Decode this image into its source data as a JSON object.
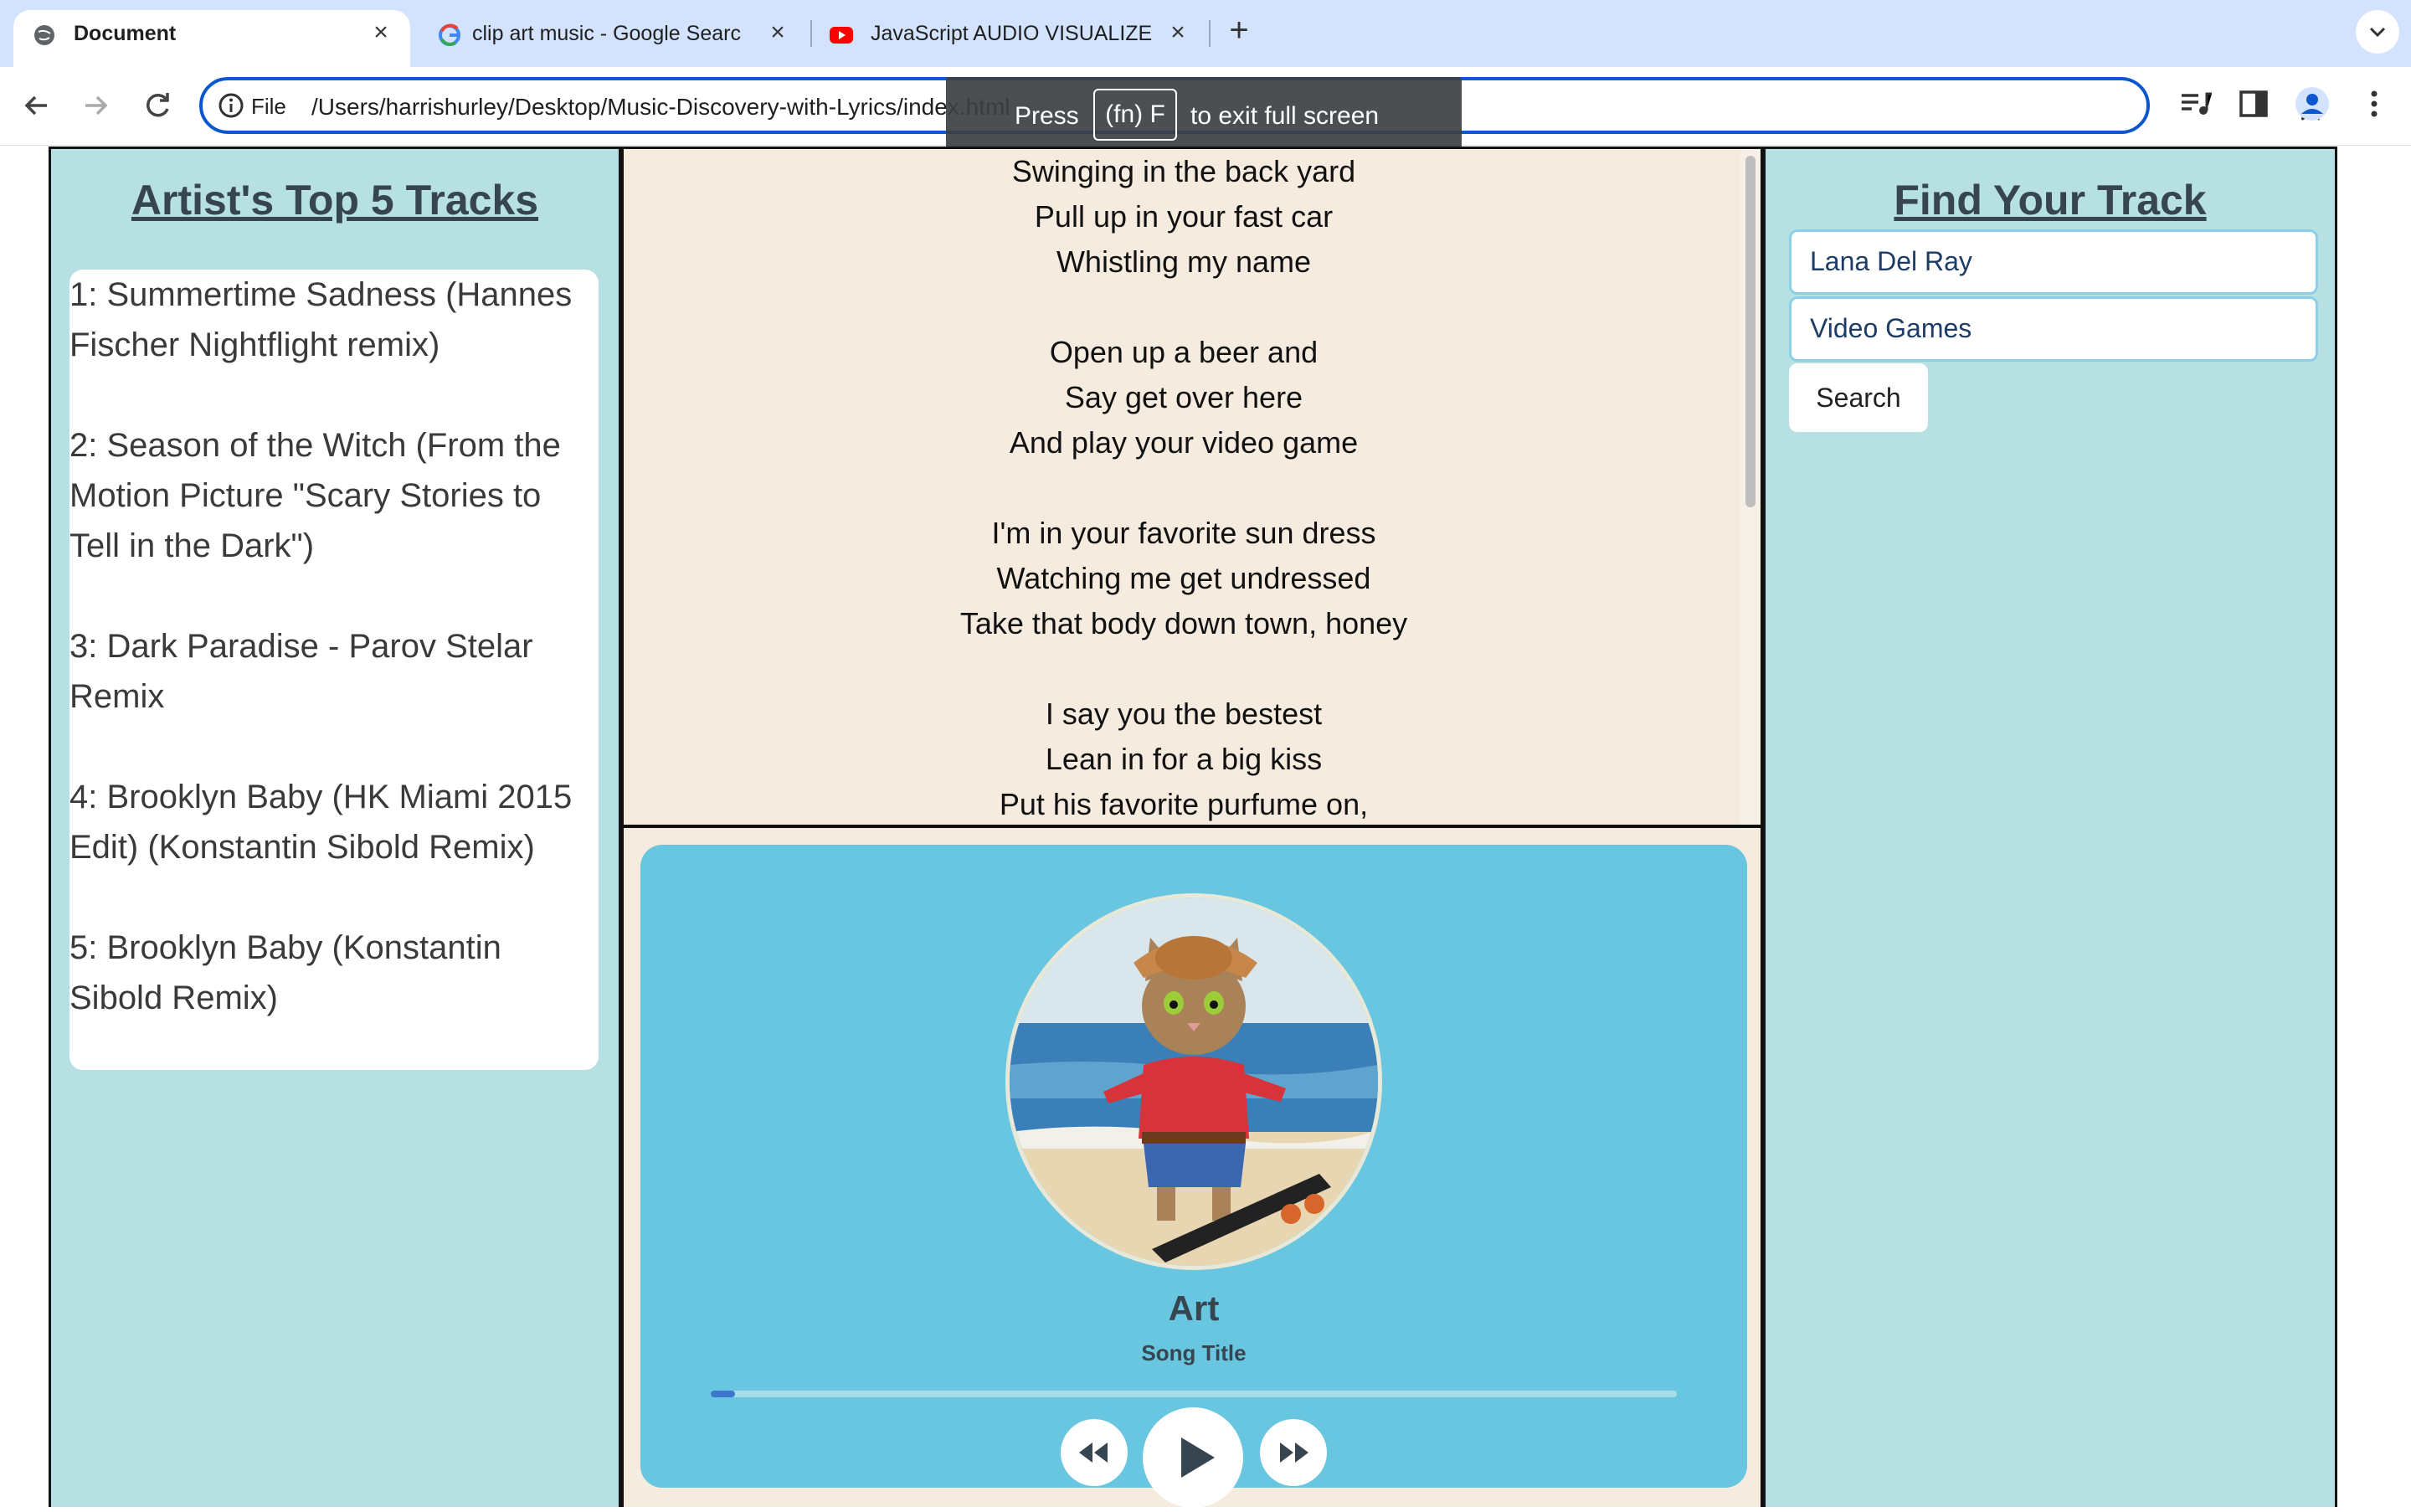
{
  "browser": {
    "tabs": [
      {
        "title": "Document"
      },
      {
        "title": "clip art music - Google Searc"
      },
      {
        "title": "JavaScript AUDIO VISUALIZE"
      }
    ],
    "omnibox": {
      "scheme_label": "File",
      "url": "/Users/harrishurley/Desktop/Music-Discovery-with-Lyrics/index.html"
    },
    "fullscreen_tip": {
      "press": "Press",
      "key": "(fn) F",
      "suffix": "to exit full screen"
    }
  },
  "left_panel": {
    "heading": "Artist's Top 5 Tracks",
    "tracks": [
      "1: Summertime Sadness (Hannes Fischer Nightflight remix)",
      "2: Season of the Witch (From the Motion Picture \"Scary Stories to Tell in the Dark\")",
      "3: Dark Paradise - Parov Stelar Remix",
      "4: Brooklyn Baby (HK Miami 2015 Edit) (Konstantin Sibold Remix)",
      "5: Brooklyn Baby (Konstantin Sibold Remix)"
    ]
  },
  "lyrics": {
    "lines": [
      "Swinging in the back yard",
      "Pull up in your fast car",
      "Whistling my name",
      "",
      "Open up a beer and",
      "Say get over here",
      "And play your video game",
      "",
      "I'm in your favorite sun dress",
      "Watching me get undressed",
      "Take that body down town, honey",
      "",
      "I say you the bestest",
      "Lean in for a big kiss",
      "Put his favorite purfume on,"
    ]
  },
  "player": {
    "artist": "Art",
    "song_title": "Song Title",
    "progress_fraction": 0.025
  },
  "search": {
    "artist_value": "Lana Del Ray",
    "song_value": "Video Games",
    "button_label": "Search",
    "heading": "Find Your Track"
  }
}
